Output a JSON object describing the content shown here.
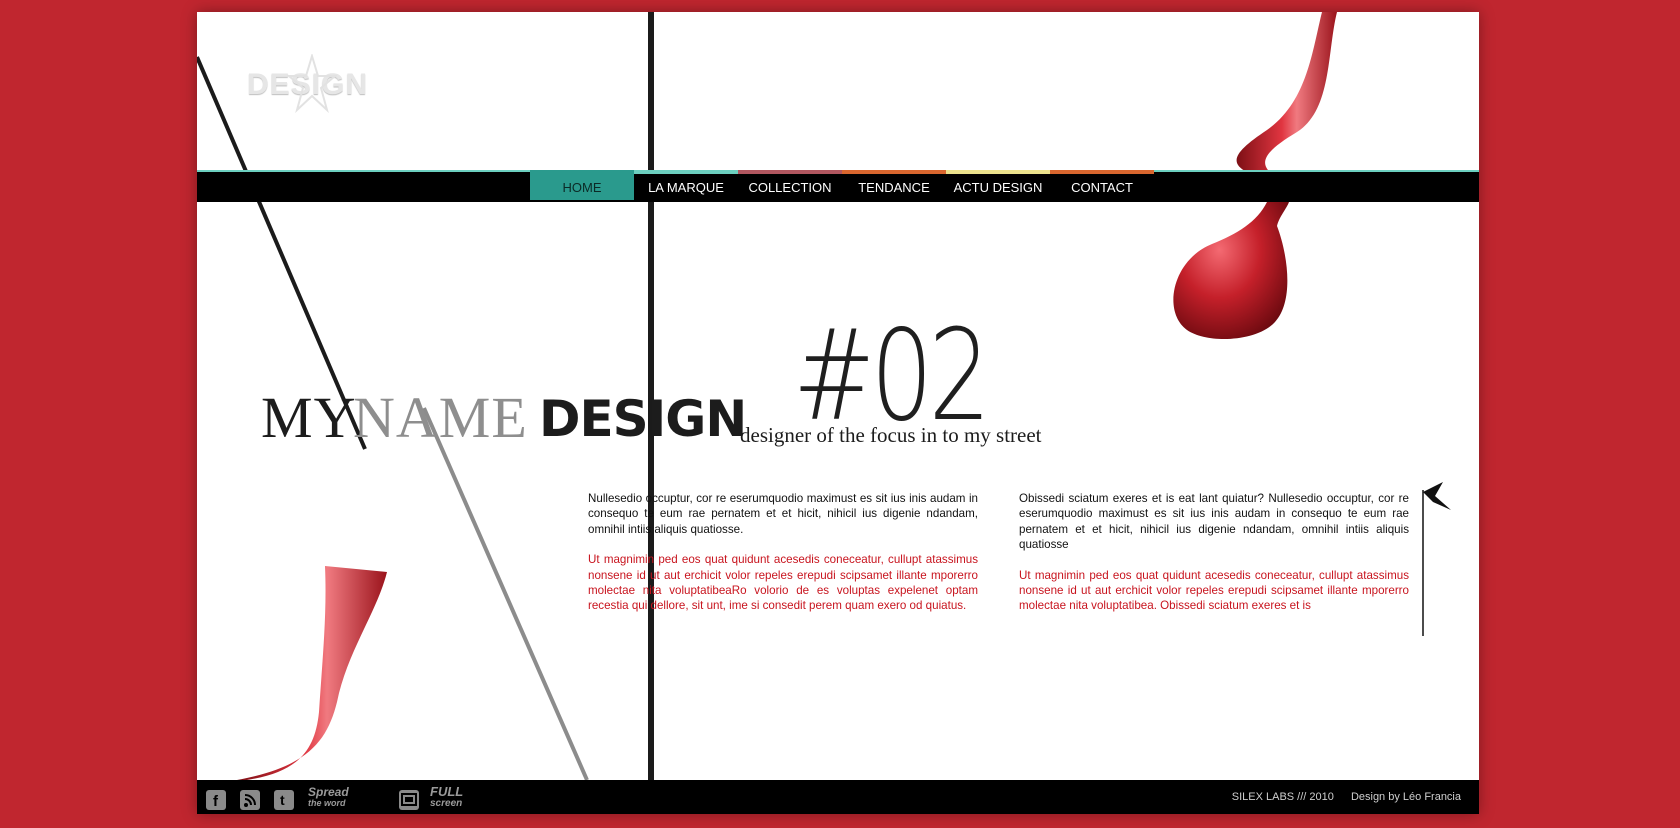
{
  "logo": {
    "text": "DESIGN"
  },
  "nav": {
    "items": [
      {
        "label": "HOME",
        "accent": "#2a9a8d",
        "active": true
      },
      {
        "label": "LA MARQUE",
        "accent": "#6ccfbf",
        "active": false
      },
      {
        "label": "COLLECTION",
        "accent": "#b0565f",
        "active": false
      },
      {
        "label": "TENDANCE",
        "accent": "#d9662e",
        "active": false
      },
      {
        "label": "ACTU DESIGN",
        "accent": "#ece28c",
        "active": false
      },
      {
        "label": "CONTACT",
        "accent": "#d9662e",
        "active": false
      }
    ]
  },
  "headline": {
    "my": "MY",
    "name": "NAME",
    "design": "DESIGN",
    "number": "#02",
    "tagline": "designer of the focus in to my street"
  },
  "content": {
    "col1": {
      "black": "Nullesedio occuptur, cor re eserumquodio maximust es sit ius inis audam in consequo te eum rae pernatem et et hicit, nihicil ius digenie ndandam, omnihil intiis aliquis quatiosse.",
      "red": "Ut magnimin ped eos quat quidunt acesedis coneceatur, cullupt atassimus nonsene id ut aut erchicit volor repeles erepudi scipsamet illante mporerro molectae nita voluptatibeaRo volorio de es voluptas expelenet optam recestia qui dellore, sit unt, ime si consedit perem quam exero od quiatus."
    },
    "col2": {
      "black": "Obissedi sciatum exeres et is eat lant quiatur? Nullesedio occuptur, cor re eserumquodio maximust es sit ius inis audam in consequo te eum rae pernatem et et hicit, nihicil ius digenie ndandam, omnihil intiis aliquis quatiosse",
      "red": "Ut magnimin ped eos quat quidunt acesedis coneceatur, cullupt atassimus nonsene id ut aut erchicit volor repeles erepudi scipsamet illante mporerro molectae nita voluptatibea. Obissedi sciatum exeres et is"
    }
  },
  "footer": {
    "social_icons": [
      "facebook-icon",
      "rss-icon",
      "twitter-icon"
    ],
    "spread_line1": "Spread",
    "spread_line2": "the word",
    "full_line1": "FULL",
    "full_line2": "screen",
    "copyright": "SILEX LABS /// 2010",
    "credit": "Design by Léo Francia"
  },
  "colors": {
    "background": "#c0262f",
    "nav_teal": "#6ccfbf",
    "accent_red": "#c8141e"
  }
}
